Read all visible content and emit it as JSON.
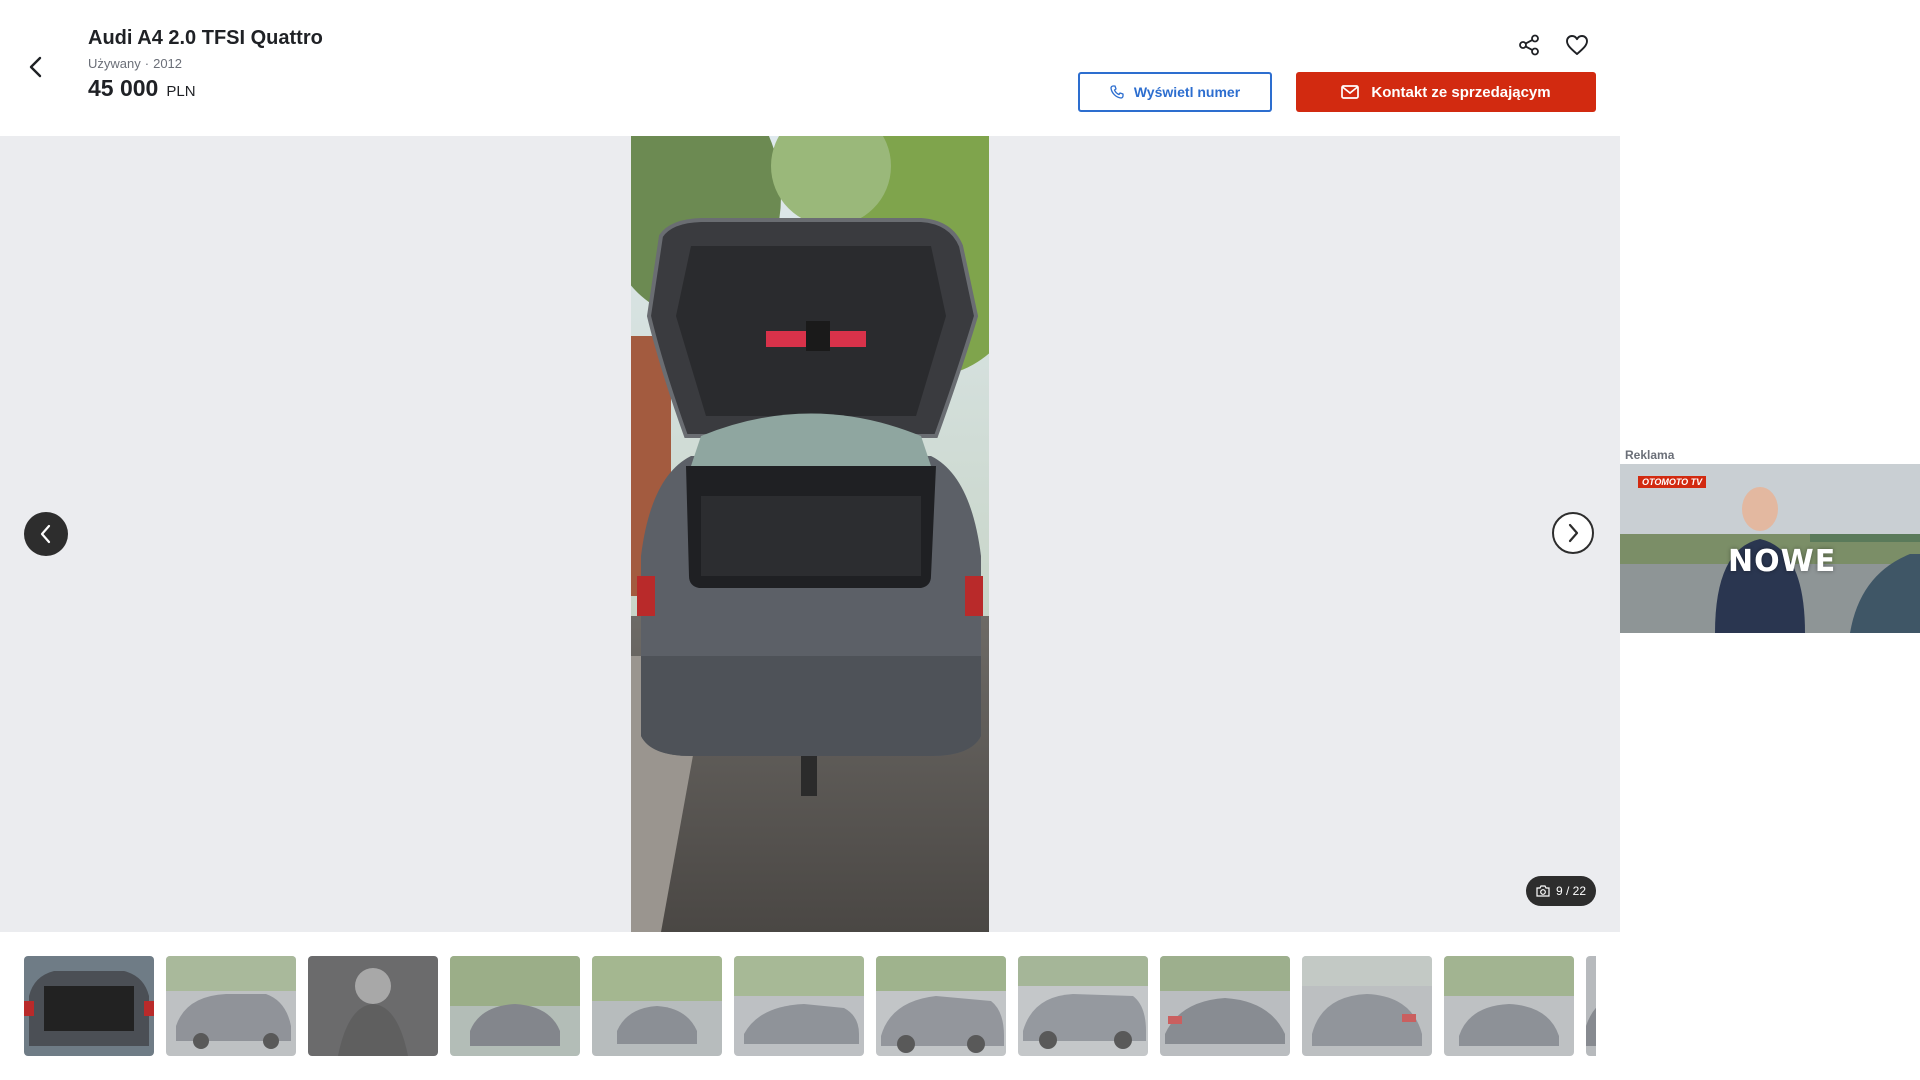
{
  "header": {
    "title": "Audi A4 2.0 TFSI Quattro",
    "condition": "Używany",
    "separator": "·",
    "year": "2012",
    "price": "45 000",
    "currency": "PLN",
    "phone_button_label": "Wyświetl numer",
    "contact_button_label": "Kontakt ze sprzedającym"
  },
  "gallery": {
    "counter": "9 / 22"
  },
  "ad": {
    "label": "Reklama",
    "brand": "OTOMOTO TV",
    "headline": "NOWE"
  },
  "colors": {
    "primary_blue": "#2d6ecf",
    "accent_red": "#d22a10",
    "gallery_bg": "#ebecef"
  },
  "thumbnails": [
    {
      "alt": "trunk"
    },
    {
      "alt": "front"
    },
    {
      "alt": "gear-shifter"
    },
    {
      "alt": "front-trees"
    },
    {
      "alt": "front-parking"
    },
    {
      "alt": "side-front"
    },
    {
      "alt": "side"
    },
    {
      "alt": "side-full"
    },
    {
      "alt": "rear-side"
    },
    {
      "alt": "rear"
    },
    {
      "alt": "rear-left"
    },
    {
      "alt": "partial"
    }
  ]
}
